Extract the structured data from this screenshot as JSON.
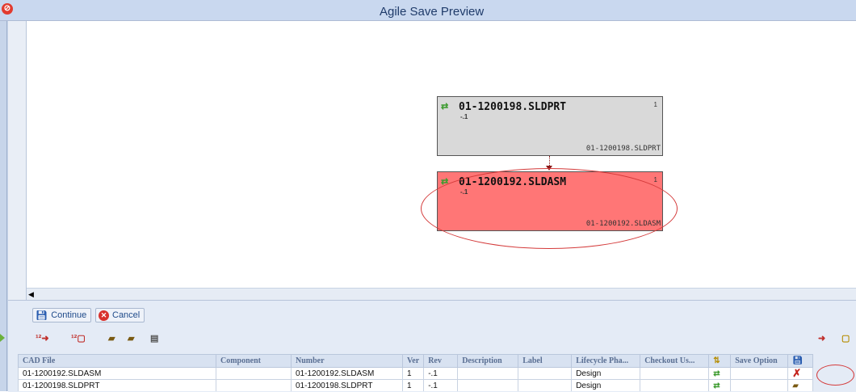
{
  "window": {
    "title": "Agile Save Preview",
    "icon": "agile-logo-icon"
  },
  "nodes": [
    {
      "name": "01-1200198.SLDPRT",
      "rev": "-.1",
      "qty": "1",
      "footer": "01-1200198.SLDPRT",
      "icon": "sync-arrows-icon"
    },
    {
      "name": "01-1200192.SLDASM",
      "rev": "-.1",
      "qty": "1",
      "footer": "01-1200192.SLDASM",
      "icon": "sync-arrows-icon"
    }
  ],
  "buttons": {
    "continue": "Continue",
    "cancel": "Cancel"
  },
  "toolbar_icons": [
    "renumber-expand-icon",
    "renumber-cube-icon",
    "folder-up-icon",
    "folder-up-all-icon",
    "document-list-icon",
    "expand-all-icon",
    "cube-icon"
  ],
  "table": {
    "headers": [
      "CAD File",
      "Component",
      "Number",
      "Ver",
      "Rev",
      "Description",
      "Label",
      "Lifecycle Pha...",
      "Checkout Us...",
      "",
      "Save Option",
      ""
    ],
    "rows": [
      [
        "01-1200192.SLDASM",
        "",
        "01-1200192.SLDASM",
        "1",
        "-.1",
        "",
        "",
        "Design",
        "",
        "",
        "",
        ""
      ],
      [
        "01-1200198.SLDPRT",
        "",
        "01-1200198.SLDPRT",
        "1",
        "-.1",
        "",
        "",
        "Design",
        "",
        "",
        "",
        ""
      ]
    ]
  },
  "colors": {
    "error_node": "#ff7676",
    "normal_node": "#d9d9d9",
    "annotation": "#d43a3a"
  }
}
